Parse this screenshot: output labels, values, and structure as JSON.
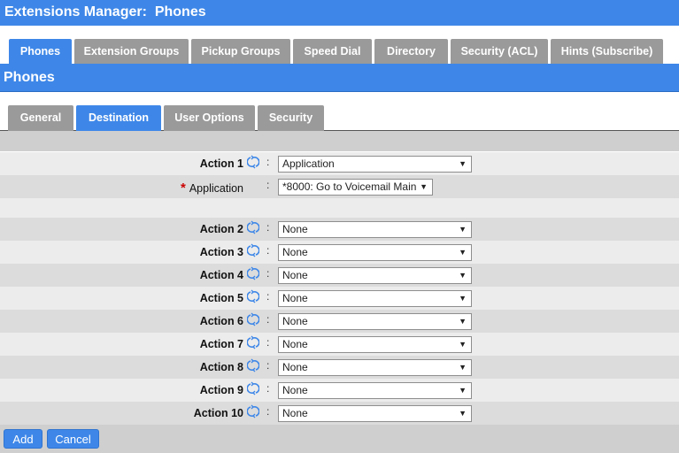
{
  "window": {
    "title": "Extensions Manager:  Phones"
  },
  "main_tabs": [
    {
      "label": "Phones",
      "active": true
    },
    {
      "label": "Extension Groups",
      "active": false
    },
    {
      "label": "Pickup Groups",
      "active": false
    },
    {
      "label": "Speed Dial",
      "active": false
    },
    {
      "label": "Directory",
      "active": false
    },
    {
      "label": "Security (ACL)",
      "active": false
    },
    {
      "label": "Hints (Subscribe)",
      "active": false
    }
  ],
  "section": {
    "title": "Phones"
  },
  "sub_tabs": [
    {
      "label": "General",
      "active": false
    },
    {
      "label": "Destination",
      "active": true
    },
    {
      "label": "User Options",
      "active": false
    },
    {
      "label": "Security",
      "active": false
    }
  ],
  "colon": ":",
  "action1": {
    "label": "Action 1",
    "value": "Application"
  },
  "application": {
    "required_mark": "*",
    "label": "Application",
    "value": "*8000: Go to Voicemail Main"
  },
  "actions": [
    {
      "label": "Action 2",
      "value": "None"
    },
    {
      "label": "Action 3",
      "value": "None"
    },
    {
      "label": "Action 4",
      "value": "None"
    },
    {
      "label": "Action 5",
      "value": "None"
    },
    {
      "label": "Action 6",
      "value": "None"
    },
    {
      "label": "Action 7",
      "value": "None"
    },
    {
      "label": "Action 8",
      "value": "None"
    },
    {
      "label": "Action 9",
      "value": "None"
    },
    {
      "label": "Action 10",
      "value": "None"
    }
  ],
  "buttons": {
    "add": "Add",
    "cancel": "Cancel"
  },
  "colors": {
    "accent": "#3e87e8",
    "tab_inactive": "#9a9a9a",
    "required": "#cc0000"
  }
}
